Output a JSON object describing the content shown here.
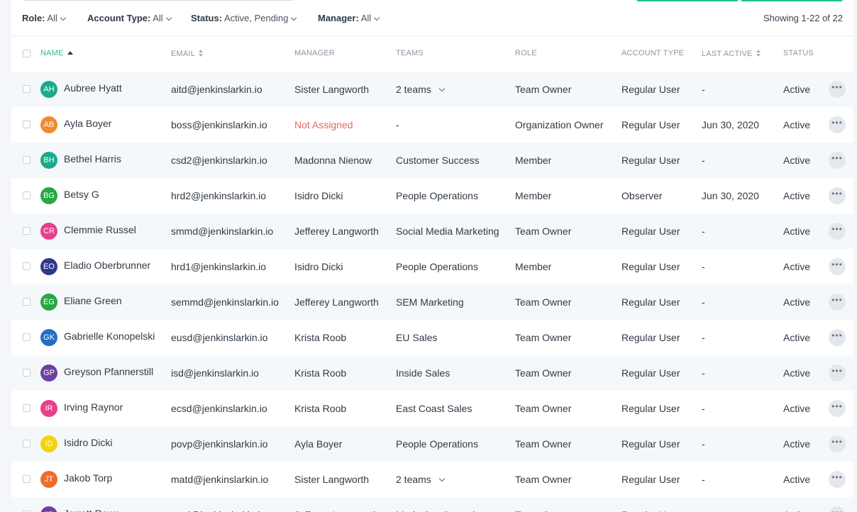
{
  "filters": {
    "role": {
      "label": "Role:",
      "value": "All"
    },
    "account_type": {
      "label": "Account Type:",
      "value": "All"
    },
    "status": {
      "label": "Status:",
      "value": "Active, Pending"
    },
    "manager": {
      "label": "Manager:",
      "value": "All"
    }
  },
  "showing": "Showing 1-22 of 22",
  "columns": {
    "name": "NAME",
    "email": "EMAIL",
    "manager": "MANAGER",
    "teams": "TEAMS",
    "role": "ROLE",
    "account_type": "ACCOUNT TYPE",
    "last_active": "LAST ACTIVE",
    "status": "STATUS"
  },
  "colors": {
    "accent": "#1fbf8f",
    "warning": "#e8685e"
  },
  "rows": [
    {
      "initials": "AH",
      "avatar_color": "#1aaa8a",
      "name": "Aubree Hyatt",
      "email": "aitd@jenkinslarkin.io",
      "manager": "Sister Langworth",
      "teams": "2 teams",
      "teams_dropdown": true,
      "role": "Team Owner",
      "account_type": "Regular User",
      "last_active": "-",
      "status": "Active"
    },
    {
      "initials": "AB",
      "avatar_color": "#f28a2e",
      "name": "Ayla Boyer",
      "email": "boss@jenkinslarkin.io",
      "manager": "Not Assigned",
      "manager_unassigned": true,
      "teams": "-",
      "role": "Organization Owner",
      "account_type": "Regular User",
      "last_active": "Jun 30, 2020",
      "status": "Active"
    },
    {
      "initials": "BH",
      "avatar_color": "#1aaa8a",
      "name": "Bethel Harris",
      "email": "csd2@jenkinslarkin.io",
      "manager": "Madonna Nienow",
      "teams": "Customer Success",
      "role": "Member",
      "account_type": "Regular User",
      "last_active": "-",
      "status": "Active"
    },
    {
      "initials": "BG",
      "avatar_color": "#27a844",
      "name": "Betsy G",
      "email": "hrd2@jenkinslarkin.io",
      "manager": "Isidro Dicki",
      "teams": "People Operations",
      "role": "Member",
      "account_type": "Observer",
      "last_active": "Jun 30, 2020",
      "status": "Active"
    },
    {
      "initials": "CR",
      "avatar_color": "#e83e8c",
      "name": "Clemmie Russel",
      "email": "smmd@jenkinslarkin.io",
      "manager": "Jefferey Langworth",
      "teams": "Social Media Marketing",
      "role": "Team Owner",
      "account_type": "Regular User",
      "last_active": "-",
      "status": "Active"
    },
    {
      "initials": "EO",
      "avatar_color": "#2d3a8c",
      "name": "Eladio Oberbrunner",
      "email": "hrd1@jenkinslarkin.io",
      "manager": "Isidro Dicki",
      "teams": "People Operations",
      "role": "Member",
      "account_type": "Regular User",
      "last_active": "-",
      "status": "Active"
    },
    {
      "initials": "EG",
      "avatar_color": "#27a844",
      "name": "Eliane Green",
      "email": "semmd@jenkinslarkin.io",
      "manager": "Jefferey Langworth",
      "teams": "SEM Marketing",
      "role": "Team Owner",
      "account_type": "Regular User",
      "last_active": "-",
      "status": "Active"
    },
    {
      "initials": "GK",
      "avatar_color": "#1f6fc4",
      "name": "Gabrielle Konopelski",
      "email": "eusd@jenkinslarkin.io",
      "manager": "Krista Roob",
      "teams": "EU Sales",
      "role": "Team Owner",
      "account_type": "Regular User",
      "last_active": "-",
      "status": "Active"
    },
    {
      "initials": "GP",
      "avatar_color": "#6f3fa0",
      "name": "Greyson Pfannerstill",
      "email": "isd@jenkinslarkin.io",
      "manager": "Krista Roob",
      "teams": "Inside Sales",
      "role": "Team Owner",
      "account_type": "Regular User",
      "last_active": "-",
      "status": "Active"
    },
    {
      "initials": "IR",
      "avatar_color": "#e83e8c",
      "name": "Irving Raynor",
      "email": "ecsd@jenkinslarkin.io",
      "manager": "Krista Roob",
      "teams": "East Coast Sales",
      "role": "Team Owner",
      "account_type": "Regular User",
      "last_active": "-",
      "status": "Active"
    },
    {
      "initials": "ID",
      "avatar_color": "#f2d40e",
      "name": "Isidro Dicki",
      "email": "povp@jenkinslarkin.io",
      "manager": "Ayla Boyer",
      "teams": "People Operations",
      "role": "Team Owner",
      "account_type": "Regular User",
      "last_active": "-",
      "status": "Active"
    },
    {
      "initials": "JT",
      "avatar_color": "#f06c28",
      "name": "Jakob Torp",
      "email": "matd@jenkinslarkin.io",
      "manager": "Sister Langworth",
      "teams": "2 teams",
      "teams_dropdown": true,
      "role": "Team Owner",
      "account_type": "Regular User",
      "last_active": "-",
      "status": "Active"
    },
    {
      "initials": "JR",
      "avatar_color": "#6f3fa0",
      "name": "Jarrett Rowe",
      "email": "mod@jenkinslarkin.io",
      "manager": "Jefferey Langworth",
      "teams": "Marketing Operations",
      "role": "Team Owner",
      "account_type": "Regular User",
      "last_active": "-",
      "status": "Active"
    }
  ]
}
